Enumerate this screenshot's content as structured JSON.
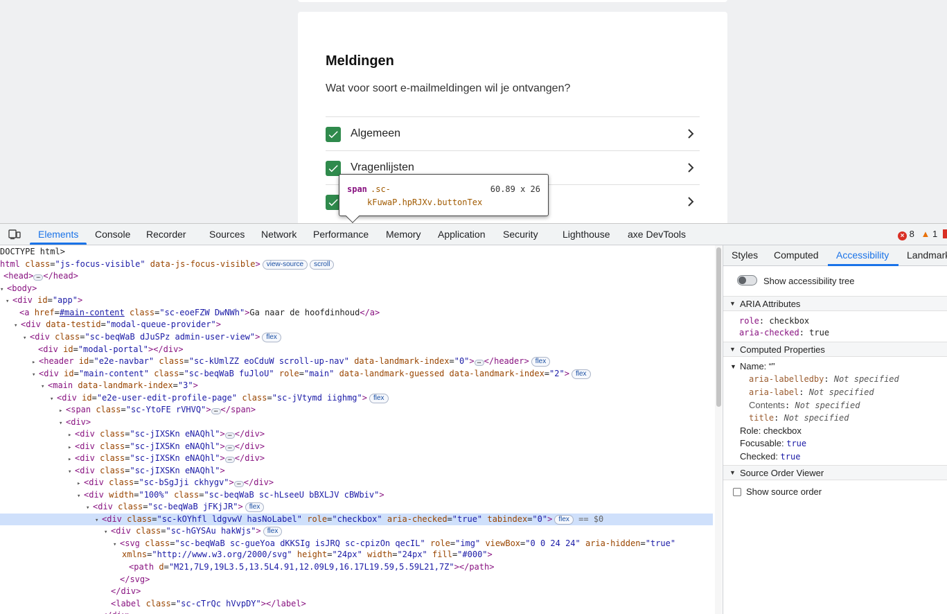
{
  "page": {
    "title": "Meldingen",
    "subtitle": "Wat voor soort e-mailmeldingen wil je ontvangen?",
    "rows": [
      {
        "label": "Algemeen",
        "checked": true
      },
      {
        "label": "Vragenlijsten",
        "checked": true
      },
      {
        "label": "",
        "checked": true
      }
    ],
    "accent_color": "#2f8a4c"
  },
  "tooltip": {
    "tag": "span",
    "class_line1": ".sc-",
    "class_line2": "kFuwaP.hpRJXv.buttonTex",
    "dims": "60.89 x 26"
  },
  "devtools": {
    "tabs": [
      "Elements",
      "Console",
      "Recorder",
      "Sources",
      "Network",
      "Performance",
      "Memory",
      "Application",
      "Security",
      "Lighthouse",
      "axe DevTools"
    ],
    "active_tab": "Elements",
    "errors": "8",
    "warnings": "1",
    "side_tabs": [
      "Styles",
      "Computed",
      "Accessibility",
      "Landmark"
    ],
    "side_active": "Accessibility",
    "show_tree_label": "Show accessibility tree",
    "sections": {
      "aria": "ARIA Attributes",
      "computed": "Computed Properties",
      "source_order": "Source Order Viewer"
    },
    "aria_attrs": [
      {
        "key": "role",
        "value": "checkbox"
      },
      {
        "key": "aria-checked",
        "value": "true"
      }
    ],
    "name_label": "Name: “”",
    "name_sources": [
      {
        "key": "aria-labelledby",
        "value": "Not specified"
      },
      {
        "key": "aria-label",
        "value": "Not specified"
      },
      {
        "key": "Contents",
        "value": "Not specified"
      },
      {
        "key": "title",
        "value": "Not specified"
      }
    ],
    "role_line": {
      "key": "Role",
      "value": "checkbox"
    },
    "focusable_line": {
      "key": "Focusable",
      "value": "true"
    },
    "checked_line": {
      "key": "Checked",
      "value": "true"
    },
    "show_source_order": "Show source order",
    "dom": {
      "doctype": "DOCTYPE html>",
      "html_open": "html",
      "html_class_attr": "class",
      "html_class_val": "\"js-focus-visible\"",
      "html_data_attr": "data-js-focus-visible",
      "badge_view_source": "view-source",
      "badge_scroll": "scroll",
      "badge_flex": "flex",
      "selected_suffix": "== $0",
      "a_href": "#main-content",
      "a_class": "\"sc-eoeFZW DwNWh\"",
      "a_text": "Ga naar de hoofdinhoud",
      "modal_testid": "\"modal-queue-provider\"",
      "admin_class": "\"sc-beqWaB dJuSPz admin-user-view\"",
      "portal_id": "\"modal-portal\"",
      "header_id": "\"e2e-navbar\"",
      "header_class": "\"sc-kUmlZZ eoCduW scroll-up-nav\"",
      "header_lm": "\"0\"",
      "main_id": "\"main-content\"",
      "main_class": "\"sc-beqWaB fuJloU\"",
      "main_role": "\"main\"",
      "main_guessed": "data-landmark-guessed",
      "main_lm": "\"2\"",
      "mainel_lm": "\"3\"",
      "profile_id": "\"e2e-user-edit-profile-page\"",
      "profile_class": "\"sc-jVtymd iighmg\"",
      "span_class": "\"sc-YtoFE rVHVQ\"",
      "repeat_class": "\"sc-jIXSKn eNAQhl\"",
      "sg_class": "\"sc-bSgJji ckhygv\"",
      "w_width": "\"100%\"",
      "w_class": "\"sc-beqWaB sc-hLseeU bBXLJV cBWbiv\"",
      "f_class": "\"sc-beqWaB jFKjJR\"",
      "sel_class": "\"sc-kOYhfl ldgvwV  hasNoLabel\"",
      "sel_role": "\"checkbox\"",
      "sel_checked": "\"true\"",
      "sel_tab": "\"0\"",
      "h_class": "\"sc-hGYSAu hakWjs\"",
      "svg_class": "\"sc-beqWaB sc-gueYoa dKKSIg isJRQ sc-cpizOn qecIL\"",
      "svg_role": "\"img\"",
      "svg_viewbox": "\"0 0 24 24\"",
      "svg_hidden": "\"true\"",
      "svg_xmlns": "\"http://www.w3.org/2000/svg\"",
      "svg_height": "\"24px\"",
      "svg_width": "\"24px\"",
      "svg_fill": "\"#000\"",
      "path_d": "\"M21,7L9,19L3.5,13.5L4.91,12.09L9,16.17L19.59,5.59L21,7Z\"",
      "label_class": "\"sc-cTrQc hVvpDY\""
    }
  }
}
